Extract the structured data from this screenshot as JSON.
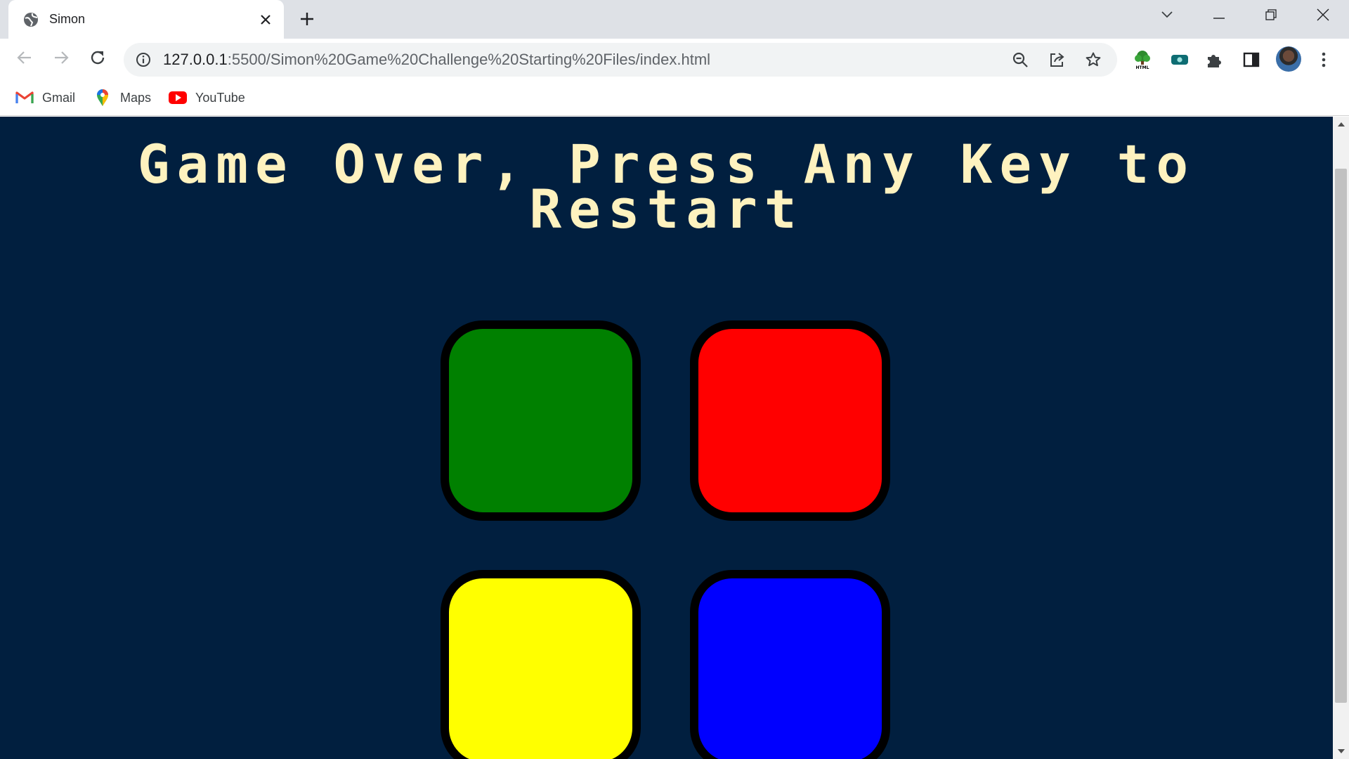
{
  "browser": {
    "tab": {
      "title": "Simon",
      "favicon": "globe-icon",
      "close_icon": "close-icon"
    },
    "new_tab_icon": "plus-icon",
    "window_controls": [
      "tab-search-icon",
      "minimize-icon",
      "restore-icon",
      "close-window-icon"
    ],
    "address_bar": {
      "host": "127.0.0.1",
      "path": ":5500/Simon%20Game%20Challenge%20Starting%20Files/index.html",
      "icons": [
        "site-info-icon",
        "zoom-out-icon",
        "share-icon",
        "bookmark-star-icon"
      ]
    },
    "extensions": [
      "html-tree-extension-icon",
      "teal-extension-icon",
      "puzzle-extensions-icon",
      "side-panel-icon"
    ],
    "menu_icon": "more-vertical-icon"
  },
  "bookmarks": [
    {
      "label": "Gmail",
      "icon": "gmail-icon"
    },
    {
      "label": "Maps",
      "icon": "maps-pin-icon"
    },
    {
      "label": "YouTube",
      "icon": "youtube-icon"
    }
  ],
  "game": {
    "title": "Game Over, Press Any Key to Restart",
    "background_color": "#011f3f",
    "title_color": "#fef2bf",
    "buttons": [
      {
        "id": "green",
        "color": "#008000"
      },
      {
        "id": "red",
        "color": "#ff0000"
      },
      {
        "id": "yellow",
        "color": "#ffff00"
      },
      {
        "id": "blue",
        "color": "#0000ff"
      }
    ]
  }
}
